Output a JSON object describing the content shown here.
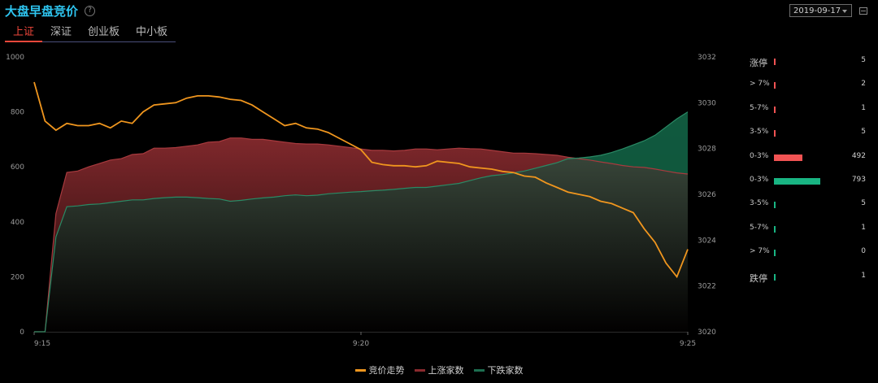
{
  "header": {
    "title": "大盘早盘竞价",
    "help_icon": "?",
    "date_value": "2019-09-17"
  },
  "tabs": [
    {
      "label": "上证",
      "active": true
    },
    {
      "label": "深证",
      "active": false
    },
    {
      "label": "创业板",
      "active": false
    },
    {
      "label": "中小板",
      "active": false
    }
  ],
  "colors": {
    "price": "#f0961e",
    "up": "#8a2a2e",
    "down": "#1d6e50",
    "up_bar": "#f15353",
    "down_bar": "#19b583"
  },
  "chart_data": {
    "type": "line",
    "x_ticks": [
      "9:15",
      "9:20",
      "9:25"
    ],
    "left_axis": {
      "range": [
        0,
        1000
      ],
      "ticks": [
        0,
        200,
        400,
        600,
        800,
        1000
      ]
    },
    "right_axis": {
      "range": [
        3020,
        3032
      ],
      "ticks": [
        3020,
        3022,
        3024,
        3026,
        3028,
        3030,
        3032
      ]
    },
    "series": [
      {
        "name": "竞价走势",
        "axis": "right",
        "values": [
          3030.9,
          3029.2,
          3028.8,
          3029.1,
          3029.0,
          3029.0,
          3029.1,
          3028.9,
          3029.2,
          3029.1,
          3029.6,
          3029.9,
          3029.95,
          3030.0,
          3030.2,
          3030.3,
          3030.3,
          3030.25,
          3030.15,
          3030.1,
          3029.9,
          3029.6,
          3029.3,
          3029.0,
          3029.1,
          3028.9,
          3028.85,
          3028.7,
          3028.45,
          3028.2,
          3027.95,
          3027.4,
          3027.3,
          3027.25,
          3027.25,
          3027.2,
          3027.25,
          3027.45,
          3027.4,
          3027.35,
          3027.2,
          3027.15,
          3027.1,
          3027.0,
          3026.95,
          3026.8,
          3026.75,
          3026.5,
          3026.3,
          3026.1,
          3026.0,
          3025.9,
          3025.7,
          3025.6,
          3025.4,
          3025.2,
          3024.5,
          3023.9,
          3023.0,
          3022.4,
          3023.6
        ]
      },
      {
        "name": "上涨家数",
        "axis": "left",
        "values": [
          0,
          0,
          430,
          580,
          585,
          600,
          612,
          625,
          630,
          645,
          648,
          668,
          668,
          670,
          675,
          680,
          690,
          692,
          705,
          705,
          700,
          700,
          695,
          690,
          685,
          683,
          683,
          680,
          675,
          670,
          665,
          660,
          660,
          658,
          660,
          665,
          665,
          662,
          665,
          668,
          666,
          665,
          660,
          655,
          650,
          650,
          648,
          645,
          642,
          635,
          630,
          625,
          618,
          612,
          605,
          600,
          598,
          592,
          585,
          578,
          574
        ]
      },
      {
        "name": "下跌家数",
        "axis": "left",
        "values": [
          0,
          0,
          345,
          455,
          458,
          463,
          465,
          470,
          475,
          480,
          480,
          485,
          488,
          490,
          490,
          488,
          485,
          483,
          475,
          478,
          483,
          487,
          490,
          495,
          498,
          495,
          497,
          502,
          505,
          508,
          510,
          513,
          515,
          518,
          522,
          525,
          525,
          530,
          535,
          540,
          550,
          560,
          568,
          572,
          578,
          585,
          595,
          605,
          615,
          630,
          632,
          636,
          642,
          652,
          665,
          680,
          695,
          715,
          745,
          775,
          800
        ]
      }
    ]
  },
  "distribution": {
    "rows": [
      {
        "label": "涨停",
        "count": "5",
        "value": 5,
        "side": "up"
      },
      {
        "label": "> 7%",
        "count": "2",
        "value": 2,
        "side": "up"
      },
      {
        "label": "5-7%",
        "count": "1",
        "value": 1,
        "side": "up"
      },
      {
        "label": "3-5%",
        "count": "5",
        "value": 5,
        "side": "up"
      },
      {
        "label": "0-3%",
        "count": "492",
        "value": 492,
        "side": "up"
      },
      {
        "label": "0-3%",
        "count": "793",
        "value": 793,
        "side": "down"
      },
      {
        "label": "3-5%",
        "count": "5",
        "value": 5,
        "side": "down"
      },
      {
        "label": "5-7%",
        "count": "1",
        "value": 1,
        "side": "down"
      },
      {
        "label": "> 7%",
        "count": "0",
        "value": 0,
        "side": "down"
      },
      {
        "label": "跌停",
        "count": "1",
        "value": 1,
        "side": "down"
      }
    ]
  },
  "legend": [
    {
      "label": "竞价走势",
      "color": "#f0961e"
    },
    {
      "label": "上涨家数",
      "color": "#8a2a2e"
    },
    {
      "label": "下跌家数",
      "color": "#1d6e50"
    }
  ]
}
